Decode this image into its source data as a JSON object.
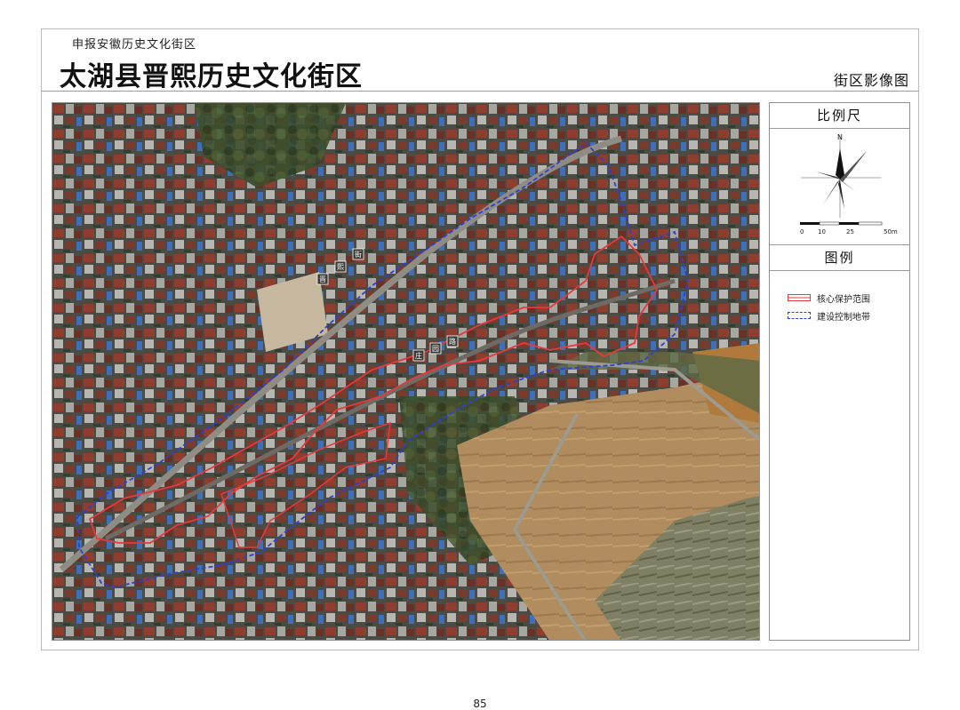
{
  "header": {
    "subtitle": "申报安徽历史文化街区",
    "title": "太湖县晋熙历史文化街区",
    "map_type": "街区影像图"
  },
  "sidebar": {
    "scale_heading": "比例尺",
    "north_label": "N",
    "scale_ticks": [
      "0",
      "10",
      "25",
      "50m"
    ],
    "legend_heading": "图例",
    "legend": [
      {
        "label": "核心保护范围",
        "color": "#e8383d",
        "style": "solid"
      },
      {
        "label": "建设控制地带",
        "color": "#2f3ed8",
        "style": "dashed"
      }
    ]
  },
  "map": {
    "core_color": "#e8383d",
    "buffer_color": "#2f3ed8",
    "street_labels": [
      "晋",
      "熙",
      "街",
      "庄",
      "园",
      "路"
    ]
  },
  "footer": {
    "page_number": "85"
  }
}
